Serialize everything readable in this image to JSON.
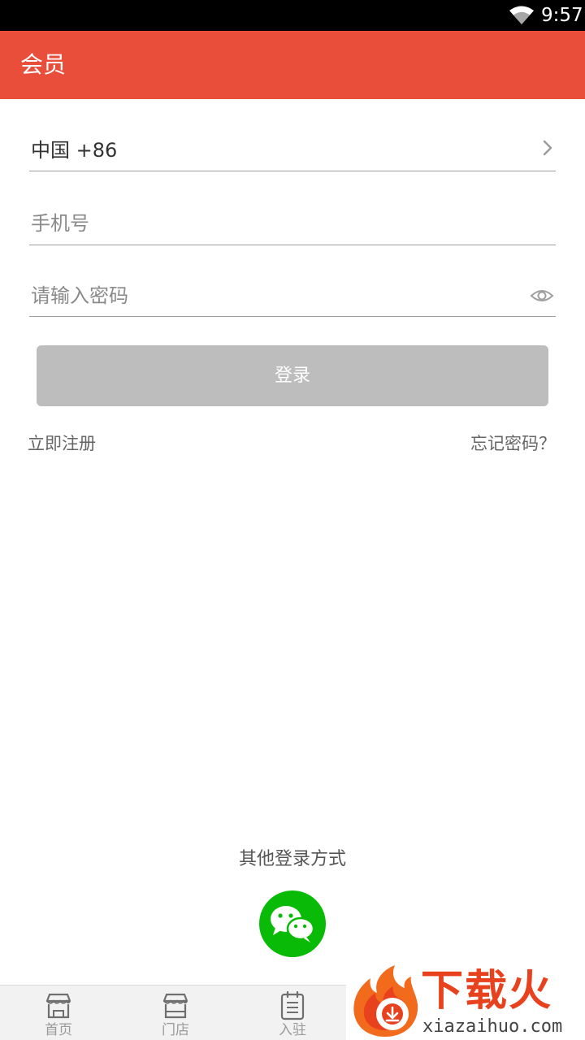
{
  "status_bar": {
    "time": "9:57",
    "wifi_icon": "wifi-icon"
  },
  "app_bar": {
    "title": "会员",
    "color": "#e94e3b"
  },
  "form": {
    "country": {
      "value": "中国 +86",
      "icon": "chevron-right-icon"
    },
    "phone": {
      "placeholder": "手机号"
    },
    "password": {
      "placeholder": "请输入密码",
      "icon": "eye-icon"
    },
    "login_label": "登录",
    "register_link": "立即注册",
    "forgot_link": "忘记密码？"
  },
  "other_login": {
    "label": "其他登录方式",
    "icon": "wechat-icon",
    "color": "#09bb07"
  },
  "bottom_nav": {
    "items": [
      {
        "label": "首页",
        "icon": "store-front-icon"
      },
      {
        "label": "门店",
        "icon": "shop-awning-icon"
      },
      {
        "label": "入驻",
        "icon": "clipboard-icon"
      }
    ]
  },
  "watermark": {
    "title": "下载火",
    "subtitle": "xiazaihuo.com",
    "color": "#e8411e"
  }
}
